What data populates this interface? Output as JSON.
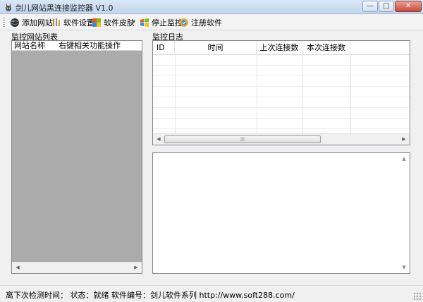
{
  "window": {
    "title": "剑儿网站黑连接监控器 V1.0",
    "controls": {
      "minimize": "—",
      "maximize": "□",
      "close": "✕"
    },
    "icon": "rabbit-app-icon"
  },
  "toolbar": {
    "items": [
      {
        "label": "添加网站",
        "icon": "globe-add-icon"
      },
      {
        "label": "软件设置",
        "icon": "tools-icon"
      },
      {
        "label": "软件皮肤",
        "icon": "skin-icon",
        "dropdown": "▾"
      },
      {
        "label": "停止监控",
        "icon": "windows-flag-icon"
      },
      {
        "label": "注册软件",
        "icon": "register-icon"
      }
    ]
  },
  "left_panel": {
    "label": "监控网站列表",
    "columns": [
      "网站名称",
      "右键相关功能操作"
    ]
  },
  "log_panel": {
    "label": "监控日志",
    "columns": [
      "ID",
      "时间",
      "上次连接数",
      "本次连接数"
    ]
  },
  "scrollbar": {
    "left_arrow": "◀",
    "right_arrow": "▶",
    "up_arrow": "▲",
    "down_arrow": "▼",
    "thumb_grip": "|||"
  },
  "statusbar": {
    "text": "离下次检测时间：  状态：就绪  软件编号：剑儿软件系列  http://www.soft288.com/"
  },
  "colors": {
    "list_background": "#ababab",
    "titlebar": "#c4d7ee",
    "close_button": "#c8493b"
  }
}
